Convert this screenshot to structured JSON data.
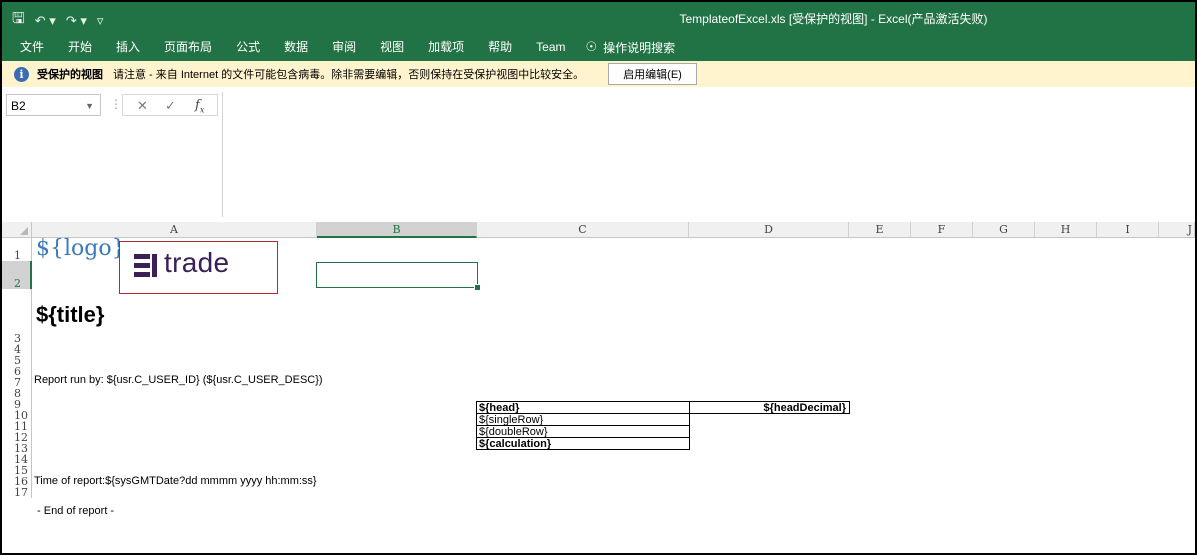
{
  "title_bar": {
    "document_title": "TemplateofExcel.xls  [受保护的视图]  -  Excel(产品激活失败)",
    "qat_icons": [
      "save-icon",
      "undo-icon",
      "redo-icon",
      "customize-icon"
    ]
  },
  "ribbon_tabs": [
    "文件",
    "开始",
    "插入",
    "页面布局",
    "公式",
    "数据",
    "审阅",
    "视图",
    "加载项",
    "帮助",
    "Team"
  ],
  "tell_me": "操作说明搜索",
  "protected_bar": {
    "label": "受保护的视图",
    "message": "请注意 - 来自 Internet 的文件可能包含病毒。除非需要编辑，否则保持在受保护视图中比较安全。",
    "button": "启用编辑(E)"
  },
  "formula_bar": {
    "name_box": "B2",
    "formula": ""
  },
  "columns": [
    "A",
    "B",
    "C",
    "D",
    "E",
    "F",
    "G",
    "H",
    "I",
    "J"
  ],
  "selected_column": "B",
  "rows": [
    "1",
    "2",
    "3",
    "4",
    "5",
    "6",
    "7",
    "8",
    "9",
    "10",
    "11",
    "12",
    "13",
    "14",
    "15",
    "16",
    "17"
  ],
  "selected_row": "2",
  "cells": {
    "logo_placeholder": "${logo}",
    "logo_brand": "trade",
    "title": "${title}",
    "report_run_by": "Report run by: ${usr.C_USER_ID} (${usr.C_USER_DESC})",
    "head": "${head}",
    "head_decimal": "${headDecimal}",
    "single_row": "${singleRow}",
    "double_row": "${doubleRow}",
    "calculation": "${calculation}",
    "time_of_report": "Time of report:${sysGMTDate?dd mmmm yyyy hh:mm:ss}",
    "end_of_report": " - End of report -"
  },
  "colors": {
    "excel_green": "#217346",
    "protected_bar": "#fff4ce",
    "logo_text": "#3c7ab6",
    "brand_purple": "#3b2058",
    "logo_border": "#b02a30"
  }
}
